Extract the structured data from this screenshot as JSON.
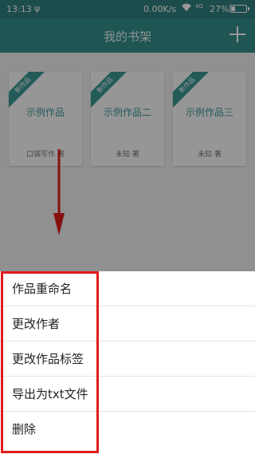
{
  "status_bar": {
    "time": "13:13",
    "usb_icon": "usb-icon",
    "network_speed": "0.00K/s",
    "wifi_icon": "wifi-icon",
    "network_type": "4G",
    "battery_percent": "27%",
    "battery_level": 0.27
  },
  "appbar": {
    "title": "我的书架",
    "add_icon": "plus-icon"
  },
  "books": [
    {
      "badge": "新作品",
      "title": "示例作品",
      "author": "口袋写作 著"
    },
    {
      "badge": "新作品",
      "title": "示例作品二",
      "author": "未知 著"
    },
    {
      "badge": "新作品",
      "title": "示例作品三",
      "author": "未知 著"
    }
  ],
  "context_menu": {
    "items": [
      "作品重命名",
      "更改作者",
      "更改作品标签",
      "导出为txt文件",
      "删除"
    ]
  },
  "colors": {
    "accent": "#35908d",
    "annotation_red": "#e01b1b"
  }
}
